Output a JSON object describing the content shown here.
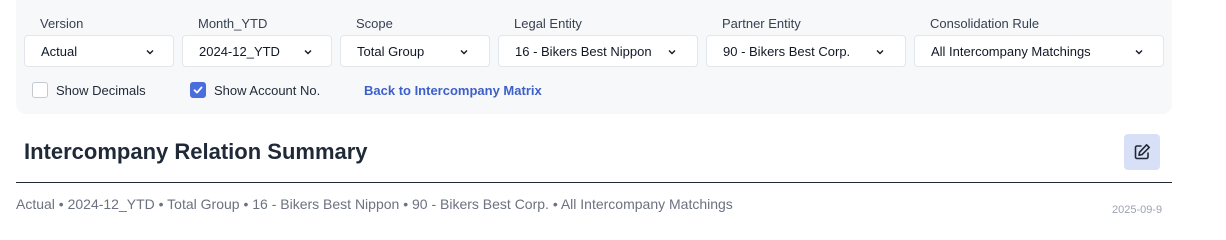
{
  "filters": {
    "version": {
      "label": "Version",
      "value": "Actual"
    },
    "month": {
      "label": "Month_YTD",
      "value": "2024-12_YTD"
    },
    "scope": {
      "label": "Scope",
      "value": "Total Group"
    },
    "legal_entity": {
      "label": "Legal Entity",
      "value": "16 - Bikers Best Nippon"
    },
    "partner_entity": {
      "label": "Partner Entity",
      "value": "90 - Bikers Best Corp."
    },
    "consolidation_rule": {
      "label": "Consolidation Rule",
      "value": "All Intercompany Matchings"
    }
  },
  "options": {
    "show_decimals": {
      "label": "Show Decimals",
      "checked": false
    },
    "show_account_no": {
      "label": "Show Account No.",
      "checked": true
    }
  },
  "links": {
    "back": "Back to Intercompany Matrix"
  },
  "header": {
    "title": "Intercompany Relation Summary",
    "edit_icon": "pencil-square-icon"
  },
  "summary": {
    "breadcrumb": "Actual • 2024-12_YTD • Total Group • 16 - Bikers Best Nippon • 90 - Bikers Best Corp. • All Intercompany Matchings",
    "date": "2025-09-9"
  },
  "colors": {
    "accent": "#4a6fdc",
    "link": "#3d5fc9",
    "edit_button_bg": "#d7e0f7",
    "panel_bg": "#f7f8fa"
  }
}
